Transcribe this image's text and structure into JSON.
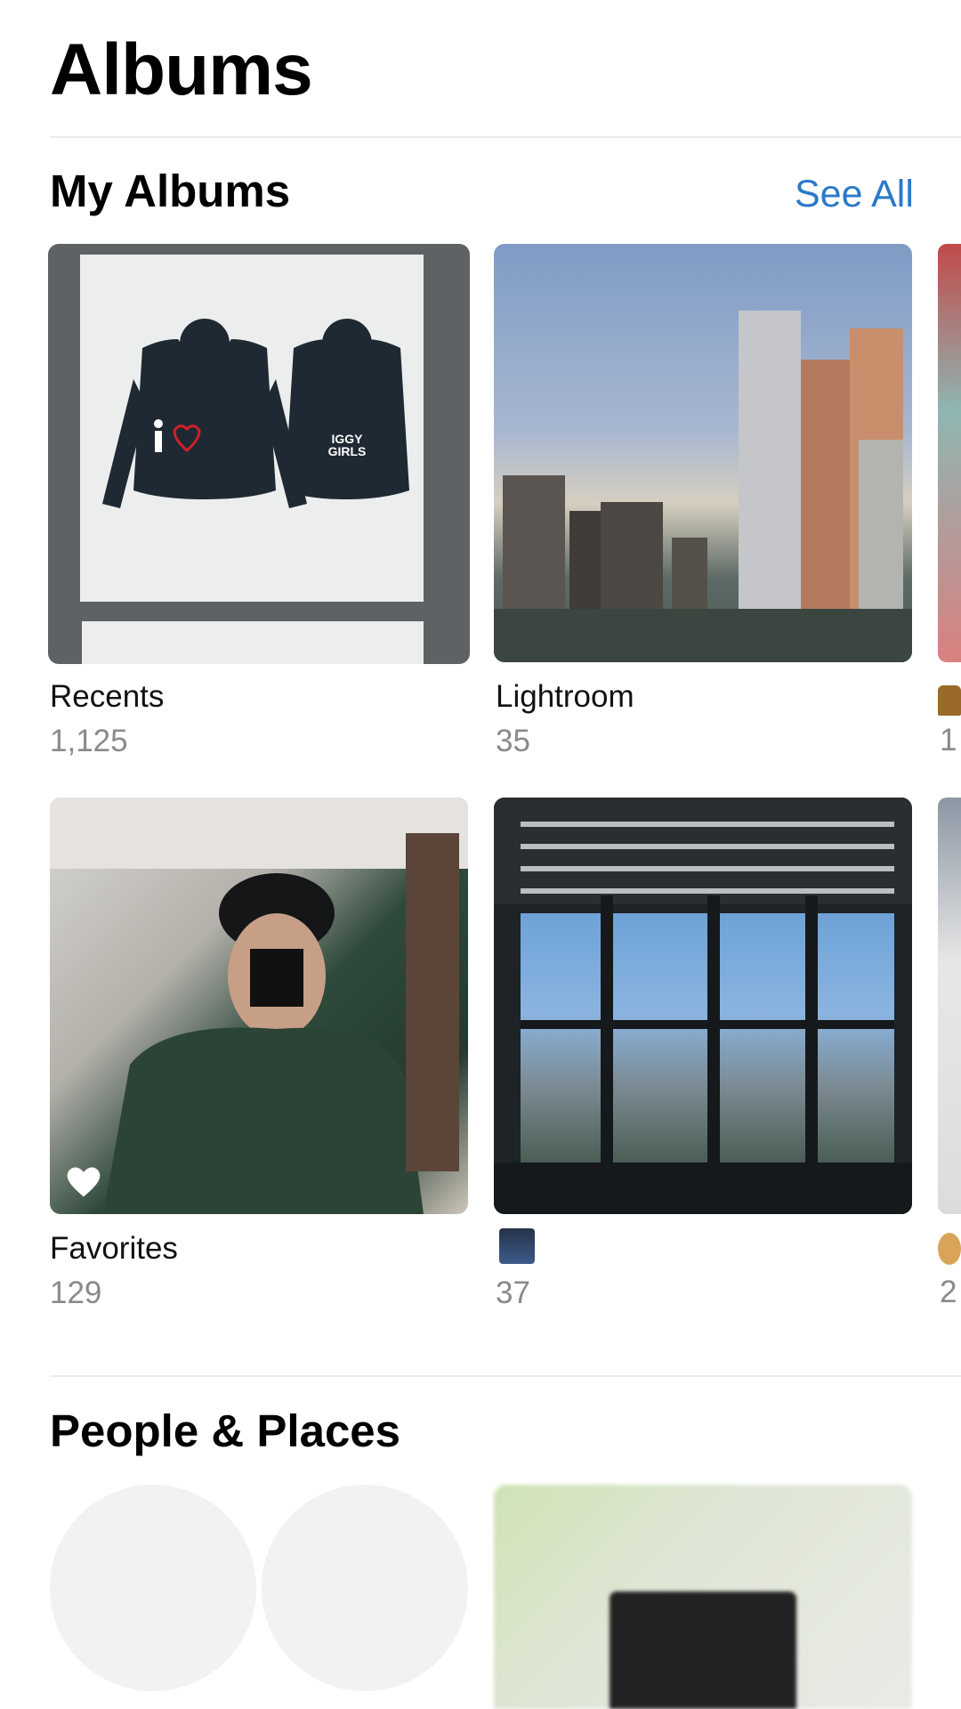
{
  "header": {
    "title": "Albums"
  },
  "my_albums": {
    "title": "My Albums",
    "see_all_label": "See All",
    "albums": [
      {
        "title": "Recents",
        "count": "1,125"
      },
      {
        "title": "Lightroom",
        "count": "35"
      },
      {
        "title": "Favorites",
        "count": "129"
      },
      {
        "title": "",
        "count": "37"
      }
    ],
    "recents_artwork_text": "IGGY GIRLS"
  },
  "people_places": {
    "title": "People & Places"
  },
  "colors": {
    "accent": "#2a79c9",
    "secondary_text": "#8a8a8e"
  },
  "icons": {
    "favorites_badge": "heart-icon"
  }
}
